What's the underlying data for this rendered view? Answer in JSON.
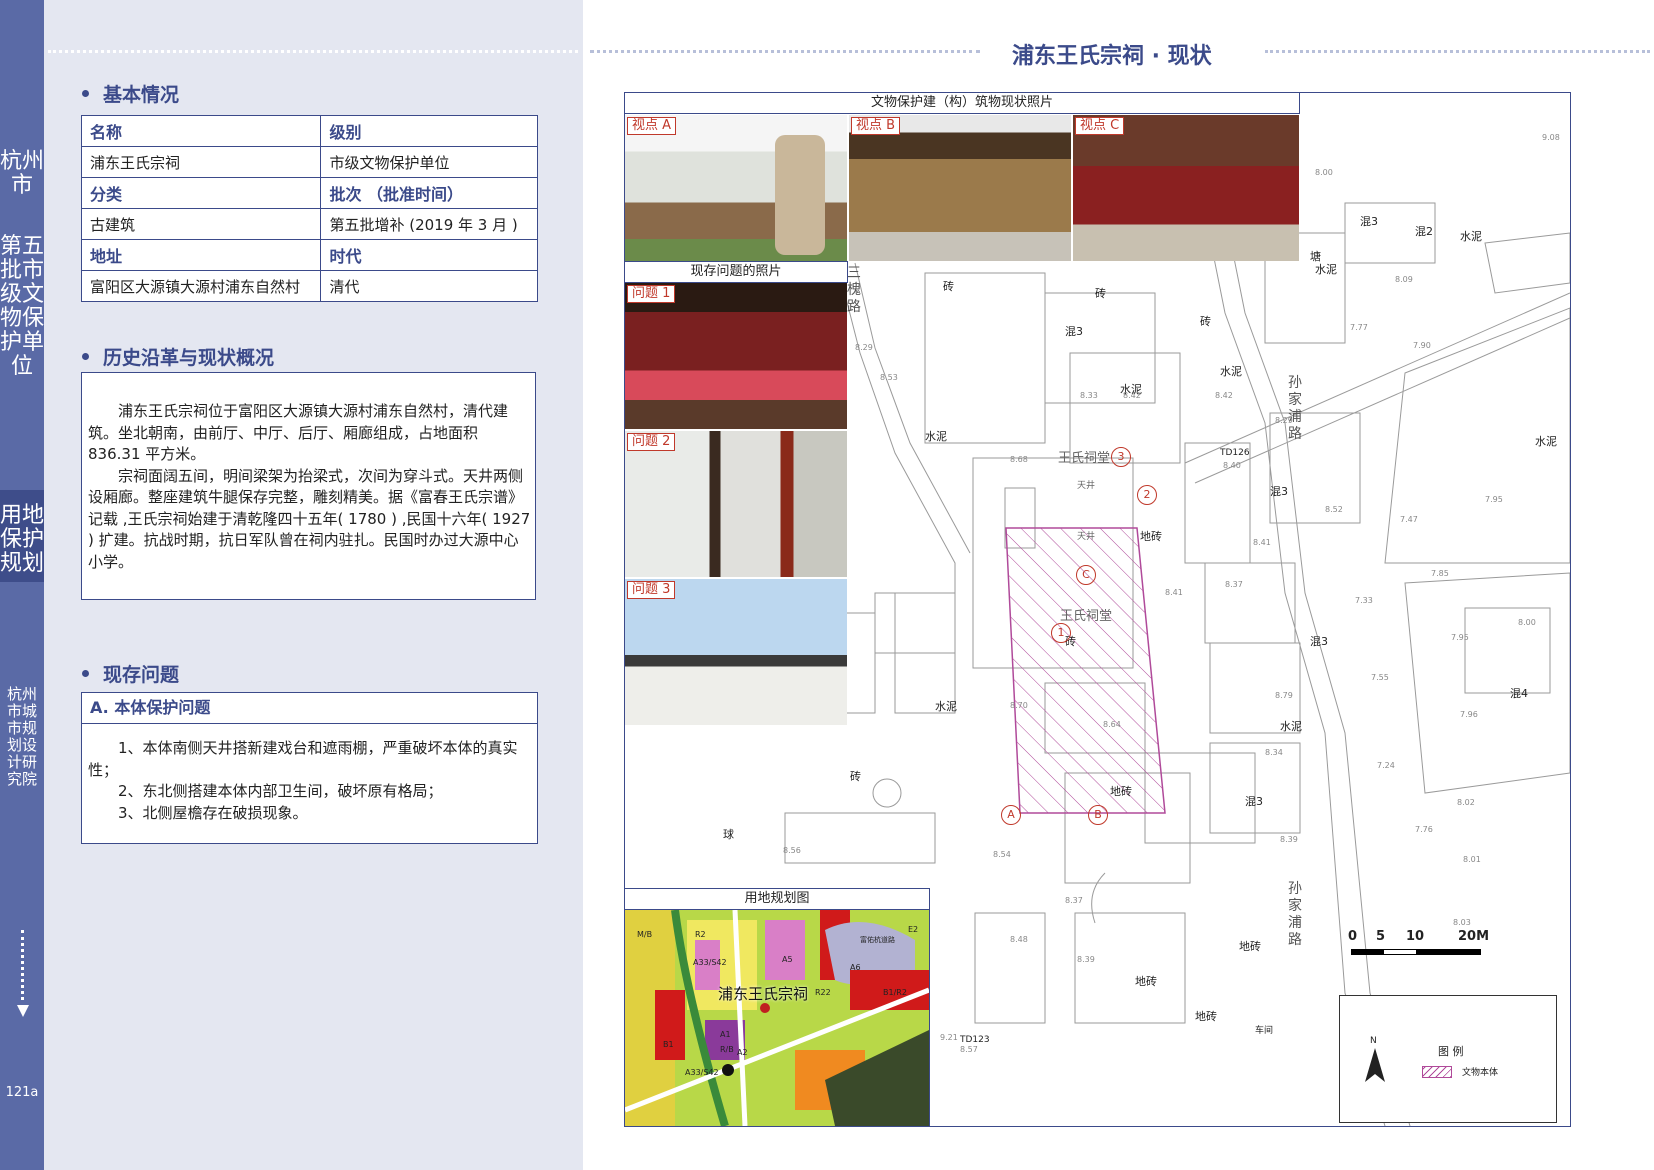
{
  "sidebar": {
    "city": "杭州市",
    "batch": "第五批市级文物保护单位",
    "plan": "用地保护规划",
    "institute": "杭州市城市规划设计研究院",
    "page": "121a"
  },
  "basic": {
    "title": "基本情况",
    "rows": [
      [
        "名称",
        "级别"
      ],
      [
        "浦东王氏宗祠",
        "市级文物保护单位"
      ],
      [
        "分类",
        "批次 （批准时间）"
      ],
      [
        "古建筑",
        "第五批增补 (2019 年 3 月 )"
      ],
      [
        "地址",
        "时代"
      ],
      [
        "富阳区大源镇大源村浦东自然村",
        "清代"
      ]
    ]
  },
  "history": {
    "title": "历史沿革与现状概况",
    "p1": "浦东王氏宗祠位于富阳区大源镇大源村浦东自然村，清代建筑。坐北朝南，由前厅、中厅、后厅、厢廊组成，占地面积 836.31 平方米。",
    "p2": "宗祠面阔五间，明间梁架为抬梁式，次间为穿斗式。天井两侧设厢廊。整座建筑牛腿保存完整，雕刻精美。据《富春王氏宗谱》记载 ,王氏宗祠始建于清乾隆四十五年( 1780 ) ,民国十六年( 1927 ) 扩建。抗战时期，抗日军队曾在祠内驻扎。民国时办过大源中心小学。"
  },
  "issues": {
    "title": "现存问题",
    "sub": "A. 本体保护问题",
    "items": [
      "1、本体南侧天井搭新建戏台和遮雨棚，严重破坏本体的真实性；",
      "2、东北侧搭建本体内部卫生间，破坏原有格局；",
      "3、北侧屋檐存在破损现象。"
    ]
  },
  "main_title": "浦东王氏宗祠 · 现状",
  "photos": {
    "caption": "文物保护建（构）筑物现状照片",
    "views": [
      "视点 A",
      "视点 B",
      "视点 C"
    ],
    "problem_caption": "现存问题的照片",
    "problems": [
      "问题 1",
      "问题 2",
      "问题 3"
    ]
  },
  "landuse": {
    "caption": "用地规划图",
    "site": "浦东王氏宗祠",
    "codes": [
      "R2",
      "A33/S42",
      "A5",
      "A6",
      "R22",
      "B1/R2",
      "R/B",
      "B1",
      "A1",
      "A2",
      "M/B",
      "E2",
      "A33/S42"
    ],
    "park": "富佑杭道路"
  },
  "map": {
    "labels": [
      "王氏祠堂",
      "王氏祠堂",
      "天井",
      "天井",
      "地砖",
      "地砖",
      "地砖",
      "地砖",
      "地砖",
      "水泥",
      "水泥",
      "水泥",
      "水泥",
      "水泥",
      "水泥",
      "水泥",
      "水泥",
      "砖",
      "砖",
      "砖",
      "砖",
      "砖",
      "砖",
      "混3",
      "混3",
      "混3",
      "混3",
      "混3",
      "混4",
      "混2",
      "塘",
      "球",
      "车间",
      "TD126",
      "TD123"
    ],
    "roads": [
      "三槐路",
      "孙家浦路",
      "孙家浦路"
    ],
    "elevations": [
      "9.08",
      "8.00",
      "8.09",
      "7.77",
      "7.90",
      "8.53",
      "8.29",
      "8.33",
      "8.42",
      "8.42",
      "8.29",
      "8.68",
      "8.40",
      "8.52",
      "7.47",
      "7.95",
      "8.41",
      "8.41",
      "8.37",
      "7.85",
      "7.33",
      "8.00",
      "7.95",
      "8.79",
      "7.55",
      "7.96",
      "8.70",
      "8.64",
      "8.34",
      "7.24",
      "8.56",
      "8.54",
      "8.39",
      "7.76",
      "8.02",
      "8.01",
      "8.37",
      "8.39",
      "8.03",
      "8.48",
      "9.21",
      "8.57"
    ],
    "markers": [
      "1",
      "2",
      "3",
      "A",
      "B",
      "C"
    ],
    "scale": [
      "0",
      "5",
      "10",
      "20M"
    ],
    "legend_title": "图  例",
    "legend_item": "文物本体",
    "north": "N"
  },
  "colors": {
    "accent": "#3b4a8a",
    "sidebar": "#5a6aa6",
    "panel": "#e4e7f1",
    "marker": "#c0392b",
    "hatch": "#b04a9a"
  }
}
